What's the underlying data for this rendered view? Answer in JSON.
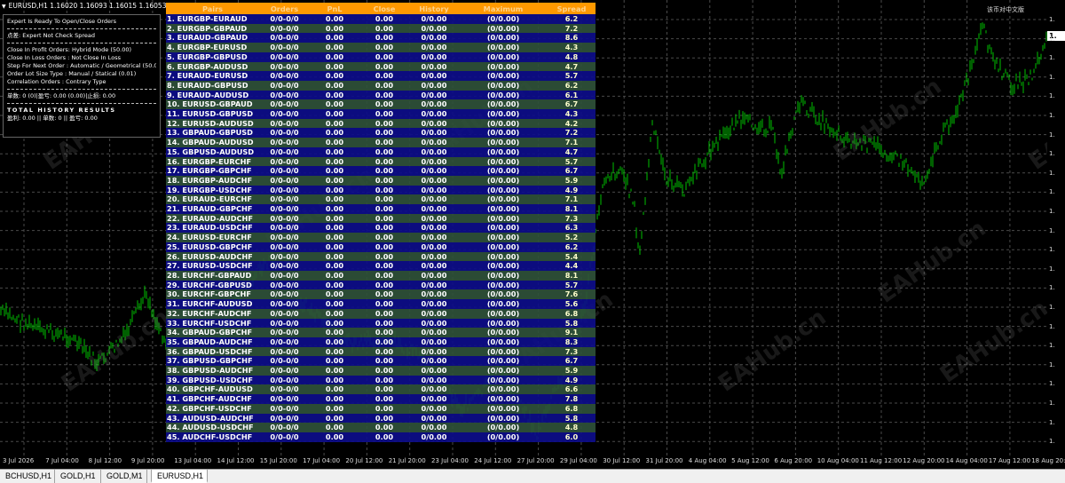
{
  "chart": {
    "symbol_header": "EURUSD,H1  1.16020 1.16093 1.16015 1.16053",
    "corner_text": "该币对中文版",
    "current_price": "1.",
    "watermark": "EAHub.cn",
    "price_labels": [
      "1.",
      "1.",
      "1.",
      "1.",
      "1.",
      "1.",
      "1.",
      "1.",
      "1.",
      "1.",
      "1.",
      "1.",
      "1.",
      "1.",
      "1.",
      "1.",
      "1.",
      "1.",
      "1.",
      "1.",
      "1.",
      "1.",
      "1."
    ],
    "time_labels": [
      "3 Jul 2026",
      "7 Jul 04:00",
      "8 Jul 12:00",
      "9 Jul 20:00",
      "13 Jul 04:00",
      "14 Jul 12:00",
      "15 Jul 20:00",
      "17 Jul 04:00",
      "20 Jul 12:00",
      "21 Jul 20:00",
      "23 Jul 04:00",
      "24 Jul 12:00",
      "27 Jul 20:00",
      "29 Jul 04:00",
      "30 Jul 12:00",
      "31 Jul 20:00",
      "4 Aug 04:00",
      "5 Aug 12:00",
      "6 Aug 20:00",
      "10 Aug 04:00",
      "11 Aug 12:00",
      "12 Aug 20:00",
      "14 Aug 04:00",
      "17 Aug 12:00",
      "18 Aug 20:00"
    ],
    "line_color": "#00c000",
    "grid_color": "#4a4a4a"
  },
  "tabs": [
    {
      "label": "BCHUSD,H1",
      "active": false
    },
    {
      "label": "GOLD,H1",
      "active": false
    },
    {
      "label": "GOLD,M1",
      "active": false
    },
    {
      "label": "EURUSD,H1",
      "active": true
    }
  ],
  "info_panel": {
    "line1": "Expert Is Ready To Open/Close Orders",
    "line2": "点差: Expert Not Check Spread",
    "line3": "Close In Profit Orders: Hybrid Mode (50.00)",
    "line4": "Close In Loss Orders   : Not Close In Loss",
    "line5": "Step For Next Order   : Automatic / Geometrical (50.0)",
    "line6": "Order Lot Size Type   : Manual / Statical (0.01)",
    "line7": "Correlation Orders      : Contrary Type",
    "line8": "单数: 0 (0)|盈亏: 0.00 (0.00)|止损: 0.00",
    "line9": "TOTAL HISTORY RESULTS",
    "line10": "盈利: 0.00 || 单数: 0 || 盈亏: 0.00"
  },
  "table": {
    "headers": [
      "Pairs",
      "Orders",
      "PnL",
      "Close",
      "History",
      "Maximum",
      "Spread"
    ],
    "rows": [
      [
        "1. EURGBP-EURAUD",
        "0/0-0/0",
        "0.00",
        "0.00",
        "0/0.00",
        "(0/0.00)",
        "6.2"
      ],
      [
        "2. EURGBP-GBPAUD",
        "0/0-0/0",
        "0.00",
        "0.00",
        "0/0.00",
        "(0/0.00)",
        "7.2"
      ],
      [
        "3. EURAUD-GBPAUD",
        "0/0-0/0",
        "0.00",
        "0.00",
        "0/0.00",
        "(0/0.00)",
        "8.6"
      ],
      [
        "4. EURGBP-EURUSD",
        "0/0-0/0",
        "0.00",
        "0.00",
        "0/0.00",
        "(0/0.00)",
        "4.3"
      ],
      [
        "5. EURGBP-GBPUSD",
        "0/0-0/0",
        "0.00",
        "0.00",
        "0/0.00",
        "(0/0.00)",
        "4.8"
      ],
      [
        "6. EURGBP-AUDUSD",
        "0/0-0/0",
        "0.00",
        "0.00",
        "0/0.00",
        "(0/0.00)",
        "4.7"
      ],
      [
        "7. EURAUD-EURUSD",
        "0/0-0/0",
        "0.00",
        "0.00",
        "0/0.00",
        "(0/0.00)",
        "5.7"
      ],
      [
        "8. EURAUD-GBPUSD",
        "0/0-0/0",
        "0.00",
        "0.00",
        "0/0.00",
        "(0/0.00)",
        "6.2"
      ],
      [
        "9. EURAUD-AUDUSD",
        "0/0-0/0",
        "0.00",
        "0.00",
        "0/0.00",
        "(0/0.00)",
        "6.1"
      ],
      [
        "10. EURUSD-GBPAUD",
        "0/0-0/0",
        "0.00",
        "0.00",
        "0/0.00",
        "(0/0.00)",
        "6.7"
      ],
      [
        "11. EURUSD-GBPUSD",
        "0/0-0/0",
        "0.00",
        "0.00",
        "0/0.00",
        "(0/0.00)",
        "4.3"
      ],
      [
        "12. EURUSD-AUDUSD",
        "0/0-0/0",
        "0.00",
        "0.00",
        "0/0.00",
        "(0/0.00)",
        "4.2"
      ],
      [
        "13. GBPAUD-GBPUSD",
        "0/0-0/0",
        "0.00",
        "0.00",
        "0/0.00",
        "(0/0.00)",
        "7.2"
      ],
      [
        "14. GBPAUD-AUDUSD",
        "0/0-0/0",
        "0.00",
        "0.00",
        "0/0.00",
        "(0/0.00)",
        "7.1"
      ],
      [
        "15. GBPUSD-AUDUSD",
        "0/0-0/0",
        "0.00",
        "0.00",
        "0/0.00",
        "(0/0.00)",
        "4.7"
      ],
      [
        "16. EURGBP-EURCHF",
        "0/0-0/0",
        "0.00",
        "0.00",
        "0/0.00",
        "(0/0.00)",
        "5.7"
      ],
      [
        "17. EURGBP-GBPCHF",
        "0/0-0/0",
        "0.00",
        "0.00",
        "0/0.00",
        "(0/0.00)",
        "6.7"
      ],
      [
        "18. EURGBP-AUDCHF",
        "0/0-0/0",
        "0.00",
        "0.00",
        "0/0.00",
        "(0/0.00)",
        "5.9"
      ],
      [
        "19. EURGBP-USDCHF",
        "0/0-0/0",
        "0.00",
        "0.00",
        "0/0.00",
        "(0/0.00)",
        "4.9"
      ],
      [
        "20. EURAUD-EURCHF",
        "0/0-0/0",
        "0.00",
        "0.00",
        "0/0.00",
        "(0/0.00)",
        "7.1"
      ],
      [
        "21. EURAUD-GBPCHF",
        "0/0-0/0",
        "0.00",
        "0.00",
        "0/0.00",
        "(0/0.00)",
        "8.1"
      ],
      [
        "22. EURAUD-AUDCHF",
        "0/0-0/0",
        "0.00",
        "0.00",
        "0/0.00",
        "(0/0.00)",
        "7.3"
      ],
      [
        "23. EURAUD-USDCHF",
        "0/0-0/0",
        "0.00",
        "0.00",
        "0/0.00",
        "(0/0.00)",
        "6.3"
      ],
      [
        "24. EURUSD-EURCHF",
        "0/0-0/0",
        "0.00",
        "0.00",
        "0/0.00",
        "(0/0.00)",
        "5.2"
      ],
      [
        "25. EURUSD-GBPCHF",
        "0/0-0/0",
        "0.00",
        "0.00",
        "0/0.00",
        "(0/0.00)",
        "6.2"
      ],
      [
        "26. EURUSD-AUDCHF",
        "0/0-0/0",
        "0.00",
        "0.00",
        "0/0.00",
        "(0/0.00)",
        "5.4"
      ],
      [
        "27. EURUSD-USDCHF",
        "0/0-0/0",
        "0.00",
        "0.00",
        "0/0.00",
        "(0/0.00)",
        "4.4"
      ],
      [
        "28. EURCHF-GBPAUD",
        "0/0-0/0",
        "0.00",
        "0.00",
        "0/0.00",
        "(0/0.00)",
        "8.1"
      ],
      [
        "29. EURCHF-GBPUSD",
        "0/0-0/0",
        "0.00",
        "0.00",
        "0/0.00",
        "(0/0.00)",
        "5.7"
      ],
      [
        "30. EURCHF-GBPCHF",
        "0/0-0/0",
        "0.00",
        "0.00",
        "0/0.00",
        "(0/0.00)",
        "7.6"
      ],
      [
        "31. EURCHF-AUDUSD",
        "0/0-0/0",
        "0.00",
        "0.00",
        "0/0.00",
        "(0/0.00)",
        "5.6"
      ],
      [
        "32. EURCHF-AUDCHF",
        "0/0-0/0",
        "0.00",
        "0.00",
        "0/0.00",
        "(0/0.00)",
        "6.8"
      ],
      [
        "33. EURCHF-USDCHF",
        "0/0-0/0",
        "0.00",
        "0.00",
        "0/0.00",
        "(0/0.00)",
        "5.8"
      ],
      [
        "34. GBPAUD-GBPCHF",
        "0/0-0/0",
        "0.00",
        "0.00",
        "0/0.00",
        "(0/0.00)",
        "9.1"
      ],
      [
        "35. GBPAUD-AUDCHF",
        "0/0-0/0",
        "0.00",
        "0.00",
        "0/0.00",
        "(0/0.00)",
        "8.3"
      ],
      [
        "36. GBPAUD-USDCHF",
        "0/0-0/0",
        "0.00",
        "0.00",
        "0/0.00",
        "(0/0.00)",
        "7.3"
      ],
      [
        "37. GBPUSD-GBPCHF",
        "0/0-0/0",
        "0.00",
        "0.00",
        "0/0.00",
        "(0/0.00)",
        "6.7"
      ],
      [
        "38. GBPUSD-AUDCHF",
        "0/0-0/0",
        "0.00",
        "0.00",
        "0/0.00",
        "(0/0.00)",
        "5.9"
      ],
      [
        "39. GBPUSD-USDCHF",
        "0/0-0/0",
        "0.00",
        "0.00",
        "0/0.00",
        "(0/0.00)",
        "4.9"
      ],
      [
        "40. GBPCHF-AUDUSD",
        "0/0-0/0",
        "0.00",
        "0.00",
        "0/0.00",
        "(0/0.00)",
        "6.6"
      ],
      [
        "41. GBPCHF-AUDCHF",
        "0/0-0/0",
        "0.00",
        "0.00",
        "0/0.00",
        "(0/0.00)",
        "7.8"
      ],
      [
        "42. GBPCHF-USDCHF",
        "0/0-0/0",
        "0.00",
        "0.00",
        "0/0.00",
        "(0/0.00)",
        "6.8"
      ],
      [
        "43. AUDUSD-AUDCHF",
        "0/0-0/0",
        "0.00",
        "0.00",
        "0/0.00",
        "(0/0.00)",
        "5.8"
      ],
      [
        "44. AUDUSD-USDCHF",
        "0/0-0/0",
        "0.00",
        "0.00",
        "0/0.00",
        "(0/0.00)",
        "4.8"
      ],
      [
        "45. AUDCHF-USDCHF",
        "0/0-0/0",
        "0.00",
        "0.00",
        "0/0.00",
        "(0/0.00)",
        "6.0"
      ]
    ]
  }
}
